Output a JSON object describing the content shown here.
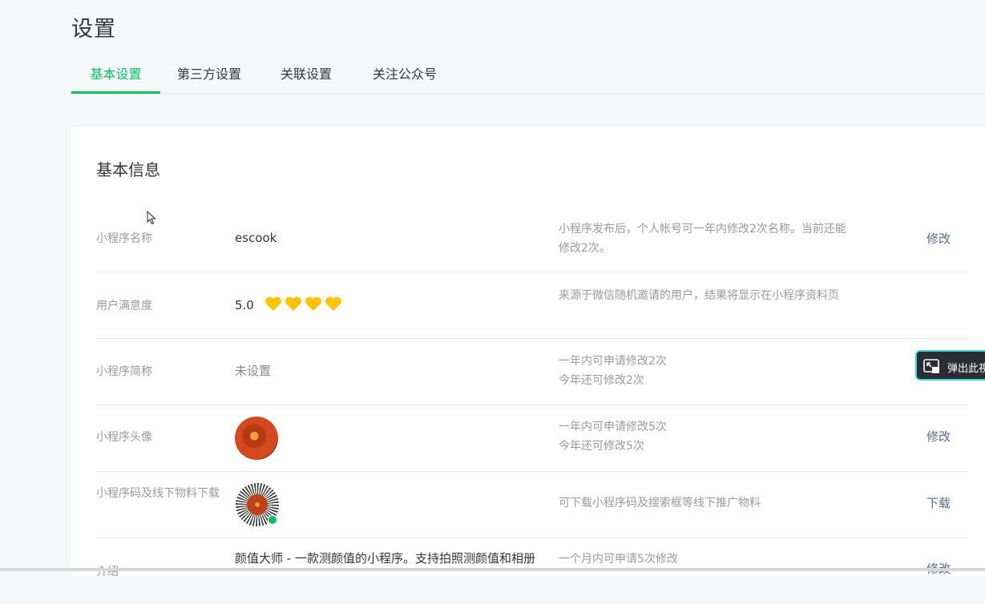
{
  "page": {
    "title": "设置"
  },
  "tabs": [
    {
      "label": "基本设置",
      "active": true
    },
    {
      "label": "第三方设置",
      "active": false
    },
    {
      "label": "关联设置",
      "active": false
    },
    {
      "label": "关注公众号",
      "active": false
    }
  ],
  "colors": {
    "accent": "#07c160",
    "link": "#576b95",
    "heart": "#ffc300"
  },
  "section": {
    "title": "基本信息"
  },
  "rows": [
    {
      "label": "小程序名称",
      "value": "escook",
      "desc": "小程序发布后，个人帐号可一年内修改2次名称。当前还能修改2次。",
      "action": "修改"
    },
    {
      "label": "用户满意度",
      "value": "5.0",
      "rating": 4,
      "desc": "来源于微信随机邀请的用户，结果将显示在小程序资料页",
      "action": ""
    },
    {
      "label": "小程序简称",
      "value": "未设置",
      "desc_line1": "一年内可申请修改2次",
      "desc_line2": "今年还可修改2次",
      "action": ""
    },
    {
      "label": "小程序头像",
      "desc_line1": "一年内可申请修改5次",
      "desc_line2": "今年还可修改5次",
      "action": "修改"
    },
    {
      "label": "小程序码及线下物料下载",
      "desc": "可下载小程序码及搜索框等线下推广物料",
      "action": "下载"
    },
    {
      "label": "介绍",
      "value": "颜值大师 - 一款测颜值的小程序。支持拍照测颜值和相册",
      "desc": "一个月内可申请5次修改",
      "action": "修改"
    }
  ],
  "popout": {
    "label": "弹出此視"
  }
}
